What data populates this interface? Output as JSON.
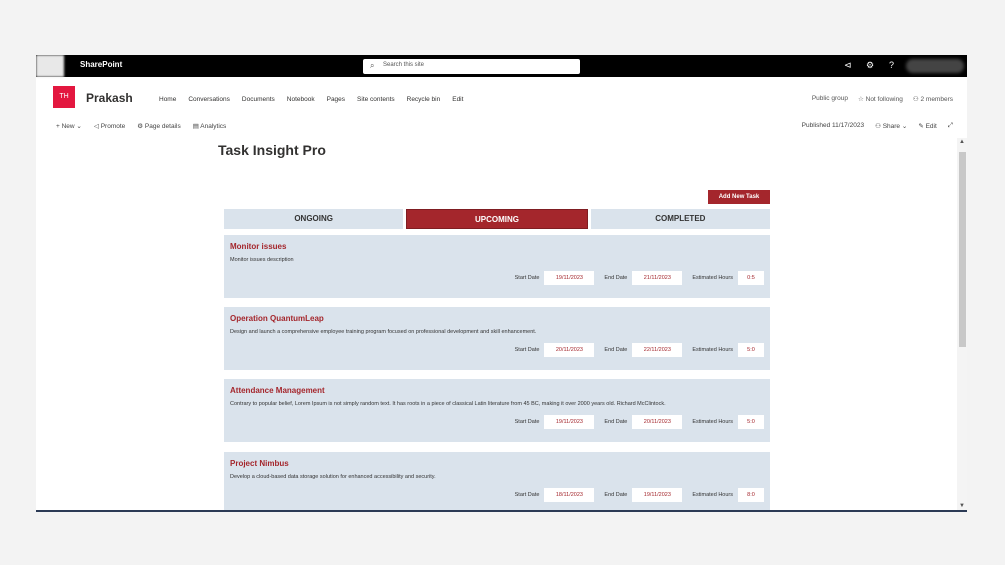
{
  "suite": {
    "brand": "SharePoint",
    "search_placeholder": "Search this site"
  },
  "site": {
    "logo": "TH",
    "name": "Prakash",
    "nav": [
      "Home",
      "Conversations",
      "Documents",
      "Notebook",
      "Pages",
      "Site contents",
      "Recycle bin",
      "Edit"
    ],
    "group": "Public group",
    "follow": "Not following",
    "members": "2 members"
  },
  "cmd": {
    "new": "New",
    "promote": "Promote",
    "details": "Page details",
    "analytics": "Analytics",
    "published": "Published 11/17/2023",
    "share": "Share",
    "edit": "Edit"
  },
  "page": {
    "title": "Task Insight Pro",
    "add": "Add New Task",
    "tabs": [
      "ONGOING",
      "UPCOMING",
      "COMPLETED"
    ]
  },
  "labels": {
    "start": "Start Date",
    "end": "End Date",
    "hours": "Estimated Hours"
  },
  "tasks": [
    {
      "title": "Monitor issues",
      "desc": "Monitor issues description",
      "start": "19/11/2023",
      "end": "21/11/2023",
      "hours": "0:5"
    },
    {
      "title": "Operation QuantumLeap",
      "desc": "Design and launch a comprehensive employee training program focused on professional development and skill enhancement.",
      "start": "20/11/2023",
      "end": "22/11/2023",
      "hours": "5:0"
    },
    {
      "title": "Attendance Management",
      "desc": "Contrary to popular belief, Lorem Ipsum is not simply random text. It has roots in a piece of classical Latin literature from 45 BC, making it over 2000 years old. Richard McClintock.",
      "start": "19/11/2023",
      "end": "20/11/2023",
      "hours": "5:0"
    },
    {
      "title": "Project Nimbus",
      "desc": "Develop a cloud-based data storage solution for enhanced accessibility and security.",
      "start": "18/11/2023",
      "end": "19/11/2023",
      "hours": "8:0"
    }
  ],
  "colors": {
    "accent": "#a4262c",
    "card": "#dae3ec"
  }
}
